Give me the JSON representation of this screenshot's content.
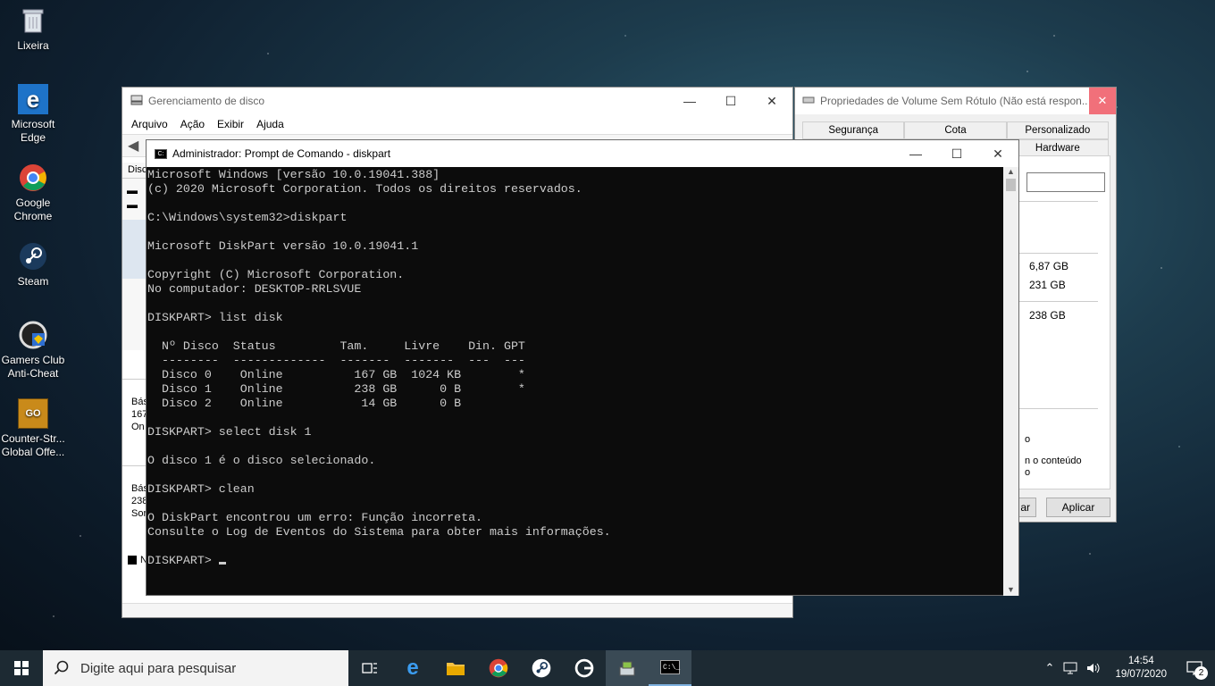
{
  "desktop": {
    "icons": [
      {
        "label": "Lixeira"
      },
      {
        "label": "Microsoft Edge"
      },
      {
        "label": "Google Chrome"
      },
      {
        "label": "Steam"
      },
      {
        "label": "Gamers Club Anti-Cheat"
      },
      {
        "label": "Counter-Str... Global Offe..."
      }
    ]
  },
  "disk_mgmt": {
    "title": "Gerenciamento de disco",
    "menu": [
      "Arquivo",
      "Ação",
      "Exibir",
      "Ajuda"
    ],
    "partial_labels": [
      "Disc",
      "Bás",
      "167",
      "On",
      "Bás",
      "238",
      "Sor",
      "N"
    ]
  },
  "props": {
    "title": "Propriedades de Volume Sem Rótulo (Não está respon...",
    "tabs_row1": [
      "Segurança",
      "Cota",
      "Personalizado"
    ],
    "tabs_row2": [
      "Hardware"
    ],
    "values": [
      "6,87 GB",
      "231 GB",
      "238 GB"
    ],
    "partial_text": [
      "o",
      "n o conteúdo",
      "o"
    ],
    "buttons": {
      "cancel_partial": "ar",
      "apply": "Aplicar"
    }
  },
  "cmd": {
    "title": "Administrador: Prompt de Comando - diskpart",
    "lines": [
      "Microsoft Windows [versão 10.0.19041.388]",
      "(c) 2020 Microsoft Corporation. Todos os direitos reservados.",
      "",
      "C:\\Windows\\system32>diskpart",
      "",
      "Microsoft DiskPart versão 10.0.19041.1",
      "",
      "Copyright (C) Microsoft Corporation.",
      "No computador: DESKTOP-RRLSVUE",
      "",
      "DISKPART> list disk",
      "",
      "  Nº Disco  Status         Tam.     Livre    Din. GPT",
      "  --------  -------------  -------  -------  ---  ---",
      "  Disco 0    Online          167 GB  1024 KB        *",
      "  Disco 1    Online          238 GB      0 B        *",
      "  Disco 2    Online           14 GB      0 B",
      "",
      "DISKPART> select disk 1",
      "",
      "O disco 1 é o disco selecionado.",
      "",
      "DISKPART> clean",
      "",
      "O DiskPart encontrou um erro: Função incorreta.",
      "Consulte o Log de Eventos do Sistema para obter mais informações.",
      ""
    ],
    "prompt": "DISKPART> "
  },
  "taskbar": {
    "search_placeholder": "Digite aqui para pesquisar",
    "time": "14:54",
    "date": "19/07/2020",
    "notification_count": "2"
  }
}
